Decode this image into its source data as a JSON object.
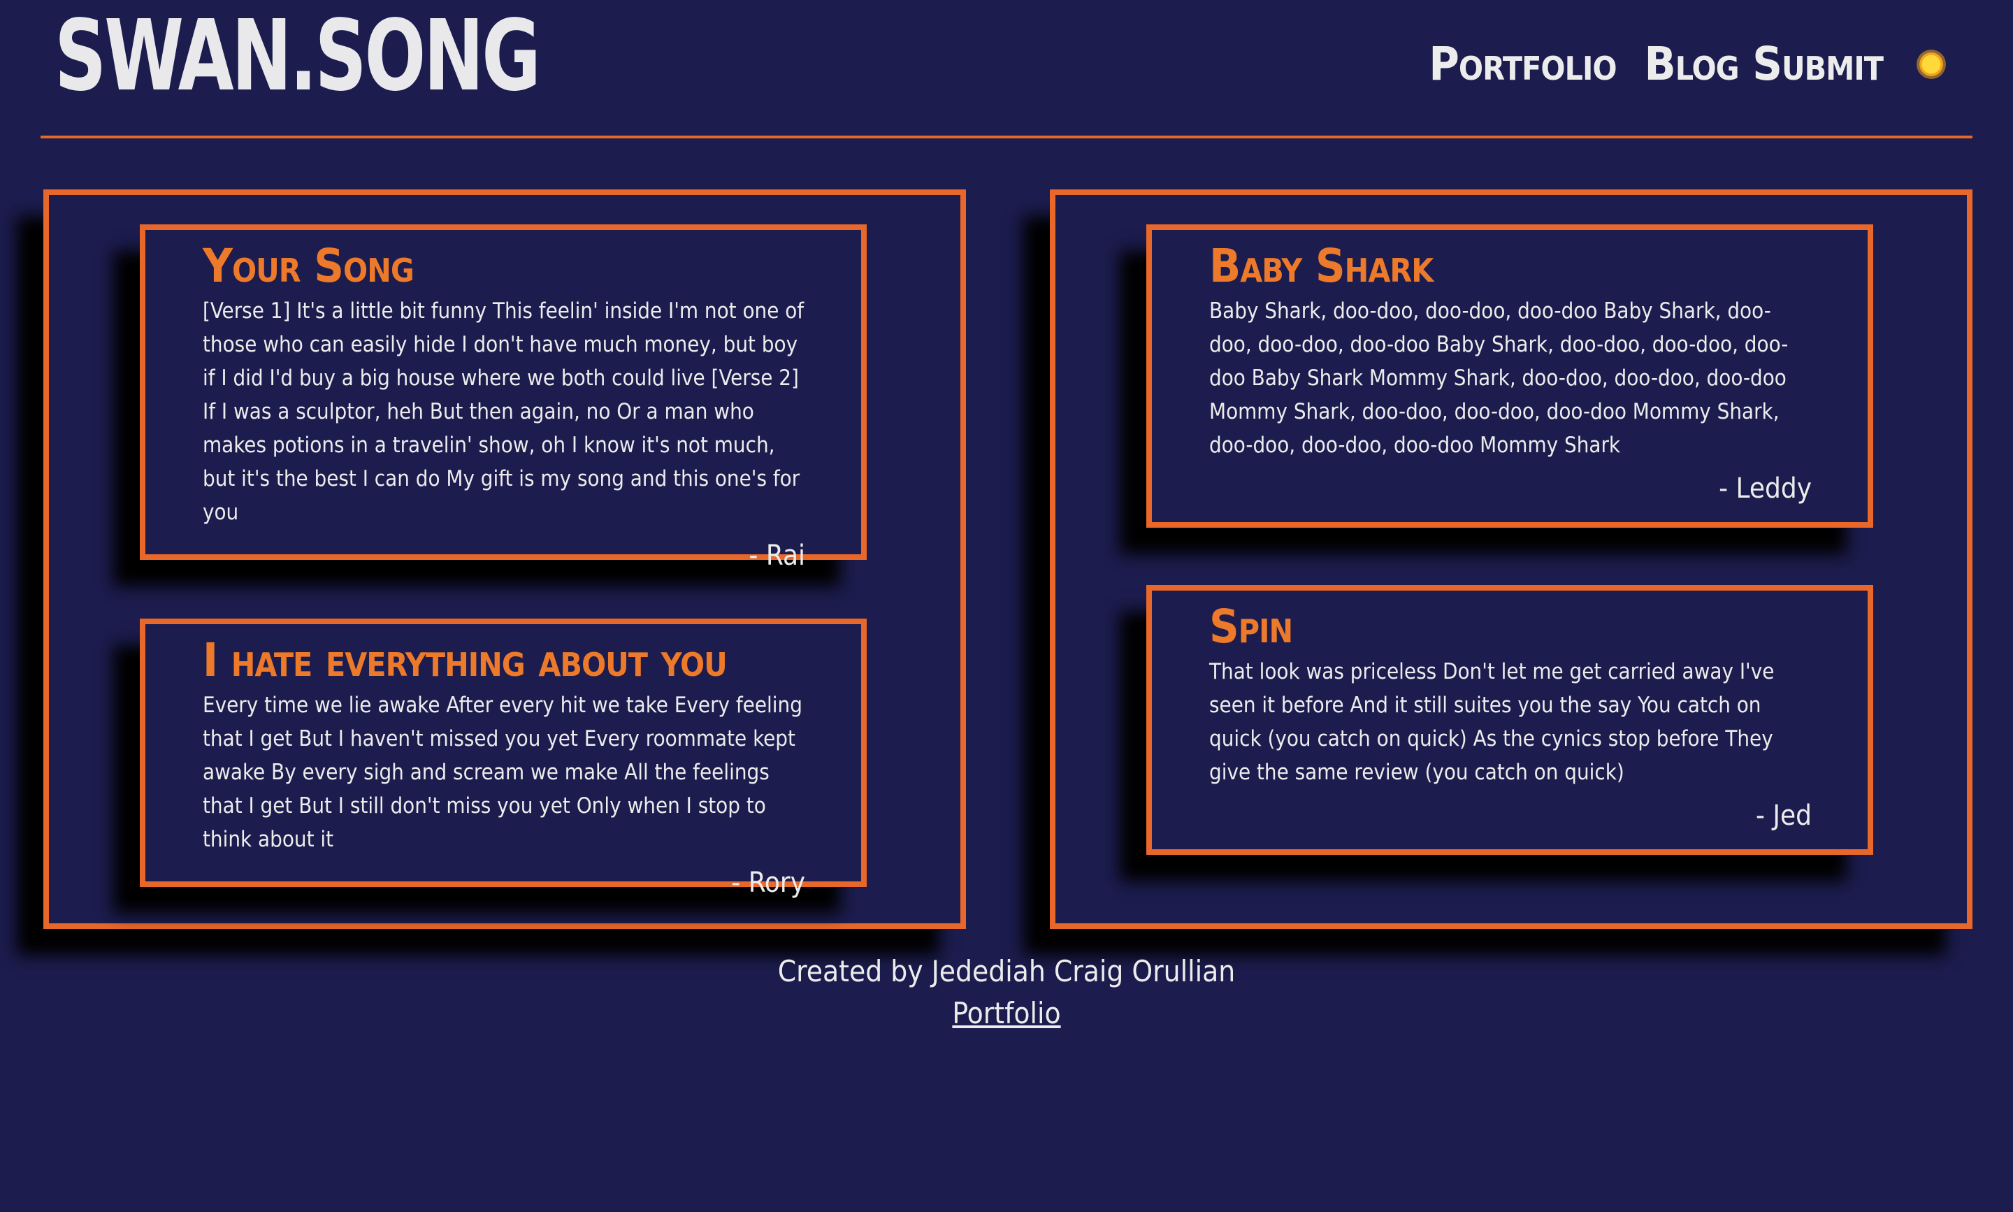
{
  "header": {
    "title": "SWAN.SONG",
    "nav": [
      {
        "label": "Portfolio"
      },
      {
        "label": "Blog Submit"
      }
    ],
    "theme_icon": "sun-icon"
  },
  "columns": [
    {
      "cards": [
        {
          "title": "Your Song",
          "body": "[Verse 1] It's a little bit funny This feelin' inside I'm not one of those who can easily hide I don't have much money, but boy if I did I'd buy a big house where we both could live [Verse 2] If I was a sculptor, heh But then again, no Or a man who makes potions in a travelin' show, oh I know it's not much, but it's the best I can do My gift is my song and this one's for you",
          "author": "- Rai"
        },
        {
          "title": "I hate everything about you",
          "body": "Every time we lie awake After every hit we take Every feeling that I get But I haven't missed you yet Every roommate kept awake By every sigh and scream we make All the feelings that I get But I still don't miss you yet Only when I stop to think about it",
          "author": "- Rory"
        }
      ]
    },
    {
      "cards": [
        {
          "title": "Baby Shark",
          "body": "Baby Shark, doo-doo, doo-doo, doo-doo Baby Shark, doo-doo, doo-doo, doo-doo Baby Shark, doo-doo, doo-doo, doo-doo Baby Shark Mommy Shark, doo-doo, doo-doo, doo-doo Mommy Shark, doo-doo, doo-doo, doo-doo Mommy Shark, doo-doo, doo-doo, doo-doo Mommy Shark",
          "author": "- Leddy"
        },
        {
          "title": "Spin",
          "body": "That look was priceless Don't let me get carried away I've seen it before And it still suites you the say You catch on quick (you catch on quick) As the cynics stop before They give the same review (you catch on quick)",
          "author": "- Jed"
        }
      ]
    }
  ],
  "footer": {
    "credit": "Created by Jedediah Craig Orullian",
    "link_label": "Portfolio"
  },
  "colors": {
    "background": "#1c1c4e",
    "accent": "#e8682a",
    "title_orange": "#ec7a2a",
    "text": "#ececec",
    "sun": "#ffd93a"
  }
}
